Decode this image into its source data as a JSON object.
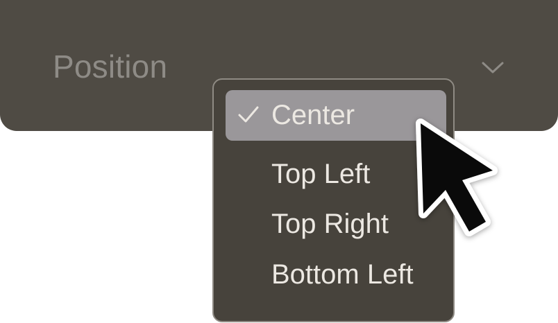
{
  "select": {
    "label": "Position",
    "icon": "chevron-down-icon"
  },
  "menu": {
    "items": [
      {
        "label": "Center",
        "selected": true
      },
      {
        "label": "Top Left",
        "selected": false
      },
      {
        "label": "Top Right",
        "selected": false
      },
      {
        "label": "Bottom Left",
        "selected": false
      }
    ]
  },
  "colors": {
    "select_bg": "#4f4b44",
    "menu_bg": "#47433c",
    "selected_bg": "#9a979a",
    "text": "#ece8e2",
    "muted_text": "#8e8b86"
  },
  "cursor": {
    "icon": "mouse-pointer-icon"
  }
}
